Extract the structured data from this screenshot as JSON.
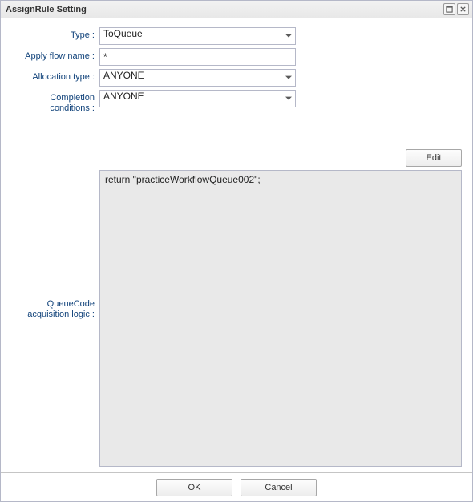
{
  "window": {
    "title": "AssignRule Setting"
  },
  "labels": {
    "type": "Type :",
    "applyFlowName": "Apply flow name :",
    "allocationType": "Allocation type :",
    "completionConditions": "Completion conditions :",
    "queueCodeLogic": "QueueCode acquisition logic :"
  },
  "fields": {
    "type": "ToQueue",
    "applyFlowName": "*",
    "allocationType": "ANYONE",
    "completionConditions": "ANYONE",
    "queueCodeLogic": "return \"practiceWorkflowQueue002\";"
  },
  "buttons": {
    "edit": "Edit",
    "ok": "OK",
    "cancel": "Cancel"
  }
}
